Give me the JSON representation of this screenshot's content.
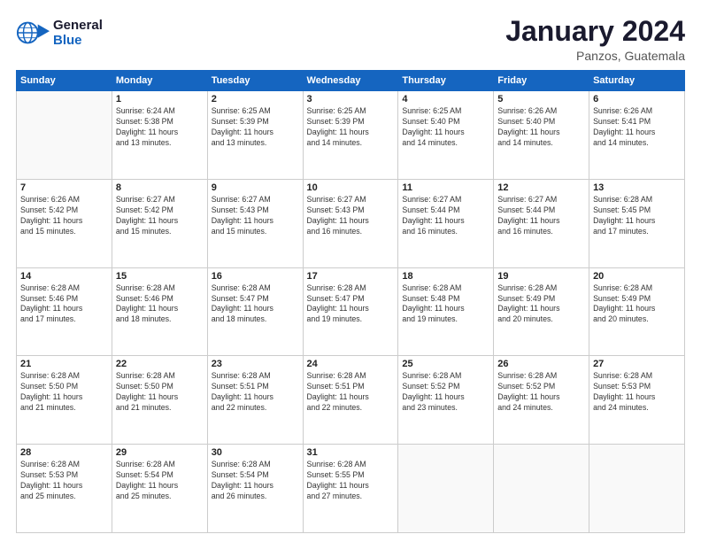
{
  "header": {
    "logo_general": "General",
    "logo_blue": "Blue",
    "title": "January 2024",
    "subtitle": "Panzos, Guatemala"
  },
  "days_of_week": [
    "Sunday",
    "Monday",
    "Tuesday",
    "Wednesday",
    "Thursday",
    "Friday",
    "Saturday"
  ],
  "weeks": [
    [
      {
        "num": "",
        "info": ""
      },
      {
        "num": "1",
        "info": "Sunrise: 6:24 AM\nSunset: 5:38 PM\nDaylight: 11 hours\nand 13 minutes."
      },
      {
        "num": "2",
        "info": "Sunrise: 6:25 AM\nSunset: 5:39 PM\nDaylight: 11 hours\nand 13 minutes."
      },
      {
        "num": "3",
        "info": "Sunrise: 6:25 AM\nSunset: 5:39 PM\nDaylight: 11 hours\nand 14 minutes."
      },
      {
        "num": "4",
        "info": "Sunrise: 6:25 AM\nSunset: 5:40 PM\nDaylight: 11 hours\nand 14 minutes."
      },
      {
        "num": "5",
        "info": "Sunrise: 6:26 AM\nSunset: 5:40 PM\nDaylight: 11 hours\nand 14 minutes."
      },
      {
        "num": "6",
        "info": "Sunrise: 6:26 AM\nSunset: 5:41 PM\nDaylight: 11 hours\nand 14 minutes."
      }
    ],
    [
      {
        "num": "7",
        "info": "Sunrise: 6:26 AM\nSunset: 5:42 PM\nDaylight: 11 hours\nand 15 minutes."
      },
      {
        "num": "8",
        "info": "Sunrise: 6:27 AM\nSunset: 5:42 PM\nDaylight: 11 hours\nand 15 minutes."
      },
      {
        "num": "9",
        "info": "Sunrise: 6:27 AM\nSunset: 5:43 PM\nDaylight: 11 hours\nand 15 minutes."
      },
      {
        "num": "10",
        "info": "Sunrise: 6:27 AM\nSunset: 5:43 PM\nDaylight: 11 hours\nand 16 minutes."
      },
      {
        "num": "11",
        "info": "Sunrise: 6:27 AM\nSunset: 5:44 PM\nDaylight: 11 hours\nand 16 minutes."
      },
      {
        "num": "12",
        "info": "Sunrise: 6:27 AM\nSunset: 5:44 PM\nDaylight: 11 hours\nand 16 minutes."
      },
      {
        "num": "13",
        "info": "Sunrise: 6:28 AM\nSunset: 5:45 PM\nDaylight: 11 hours\nand 17 minutes."
      }
    ],
    [
      {
        "num": "14",
        "info": "Sunrise: 6:28 AM\nSunset: 5:46 PM\nDaylight: 11 hours\nand 17 minutes."
      },
      {
        "num": "15",
        "info": "Sunrise: 6:28 AM\nSunset: 5:46 PM\nDaylight: 11 hours\nand 18 minutes."
      },
      {
        "num": "16",
        "info": "Sunrise: 6:28 AM\nSunset: 5:47 PM\nDaylight: 11 hours\nand 18 minutes."
      },
      {
        "num": "17",
        "info": "Sunrise: 6:28 AM\nSunset: 5:47 PM\nDaylight: 11 hours\nand 19 minutes."
      },
      {
        "num": "18",
        "info": "Sunrise: 6:28 AM\nSunset: 5:48 PM\nDaylight: 11 hours\nand 19 minutes."
      },
      {
        "num": "19",
        "info": "Sunrise: 6:28 AM\nSunset: 5:49 PM\nDaylight: 11 hours\nand 20 minutes."
      },
      {
        "num": "20",
        "info": "Sunrise: 6:28 AM\nSunset: 5:49 PM\nDaylight: 11 hours\nand 20 minutes."
      }
    ],
    [
      {
        "num": "21",
        "info": "Sunrise: 6:28 AM\nSunset: 5:50 PM\nDaylight: 11 hours\nand 21 minutes."
      },
      {
        "num": "22",
        "info": "Sunrise: 6:28 AM\nSunset: 5:50 PM\nDaylight: 11 hours\nand 21 minutes."
      },
      {
        "num": "23",
        "info": "Sunrise: 6:28 AM\nSunset: 5:51 PM\nDaylight: 11 hours\nand 22 minutes."
      },
      {
        "num": "24",
        "info": "Sunrise: 6:28 AM\nSunset: 5:51 PM\nDaylight: 11 hours\nand 22 minutes."
      },
      {
        "num": "25",
        "info": "Sunrise: 6:28 AM\nSunset: 5:52 PM\nDaylight: 11 hours\nand 23 minutes."
      },
      {
        "num": "26",
        "info": "Sunrise: 6:28 AM\nSunset: 5:52 PM\nDaylight: 11 hours\nand 24 minutes."
      },
      {
        "num": "27",
        "info": "Sunrise: 6:28 AM\nSunset: 5:53 PM\nDaylight: 11 hours\nand 24 minutes."
      }
    ],
    [
      {
        "num": "28",
        "info": "Sunrise: 6:28 AM\nSunset: 5:53 PM\nDaylight: 11 hours\nand 25 minutes."
      },
      {
        "num": "29",
        "info": "Sunrise: 6:28 AM\nSunset: 5:54 PM\nDaylight: 11 hours\nand 25 minutes."
      },
      {
        "num": "30",
        "info": "Sunrise: 6:28 AM\nSunset: 5:54 PM\nDaylight: 11 hours\nand 26 minutes."
      },
      {
        "num": "31",
        "info": "Sunrise: 6:28 AM\nSunset: 5:55 PM\nDaylight: 11 hours\nand 27 minutes."
      },
      {
        "num": "",
        "info": ""
      },
      {
        "num": "",
        "info": ""
      },
      {
        "num": "",
        "info": ""
      }
    ]
  ]
}
